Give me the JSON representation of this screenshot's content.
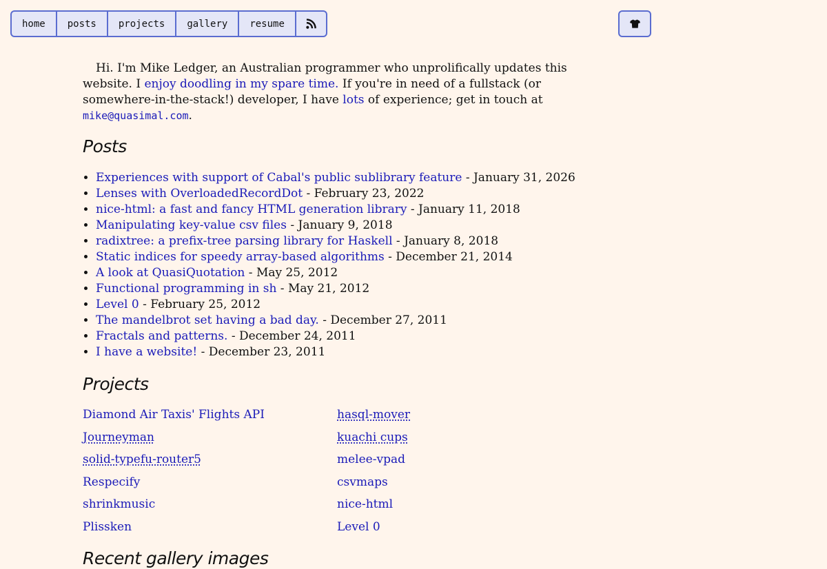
{
  "nav": {
    "items": [
      {
        "label": "home"
      },
      {
        "label": "posts"
      },
      {
        "label": "projects"
      },
      {
        "label": "gallery"
      },
      {
        "label": "resume"
      }
    ],
    "rss_icon": "rss-icon",
    "theme_icon": "tshirt-icon"
  },
  "intro": {
    "text1": "Hi. I'm Mike Ledger, an Australian programmer who unprolifically updates this website. I ",
    "link1": "enjoy doodling in my spare time.",
    "text2": " If you're in need of a fullstack (or somewhere-in-the-stack!) developer, I have ",
    "link2": "lots",
    "text3": " of experience; get in touch at ",
    "email": "mike@quasimal.com",
    "text4": "."
  },
  "posts": {
    "heading": "Posts",
    "items": [
      {
        "title": "Experiences with support of Cabal's public sublibrary feature",
        "date": " - January 31, 2026"
      },
      {
        "title": "Lenses with OverloadedRecordDot",
        "date": " - February 23, 2022"
      },
      {
        "title": "nice-html: a fast and fancy HTML generation library",
        "date": " - January 11, 2018"
      },
      {
        "title": "Manipulating key-value csv files",
        "date": " - January 9, 2018"
      },
      {
        "title": "radixtree: a prefix-tree parsing library for Haskell",
        "date": " - January 8, 2018"
      },
      {
        "title": "Static indices for speedy array-based algorithms",
        "date": " - December 21, 2014"
      },
      {
        "title": "A look at QuasiQuotation",
        "date": " - May 25, 2012"
      },
      {
        "title": "Functional programming in sh",
        "date": " - May 21, 2012"
      },
      {
        "title": "Level 0",
        "date": " - February 25, 2012"
      },
      {
        "title": "The mandelbrot set having a bad day.",
        "date": " - December 27, 2011"
      },
      {
        "title": "Fractals and patterns.",
        "date": " - December 24, 2011"
      },
      {
        "title": "I have a website!",
        "date": " - December 23, 2011"
      }
    ]
  },
  "projects": {
    "heading": "Projects",
    "items": [
      {
        "label": "Diamond Air Taxis' Flights API"
      },
      {
        "label": "hasql-mover"
      },
      {
        "label": "Journeyman"
      },
      {
        "label": "kuachi cups"
      },
      {
        "label": "solid-typefu-router5"
      },
      {
        "label": "melee-vpad"
      },
      {
        "label": "Respecify"
      },
      {
        "label": "csvmaps"
      },
      {
        "label": "shrinkmusic"
      },
      {
        "label": "nice-html"
      },
      {
        "label": "Plissken"
      },
      {
        "label": "Level 0"
      }
    ]
  },
  "gallery": {
    "heading": "Recent gallery images"
  }
}
